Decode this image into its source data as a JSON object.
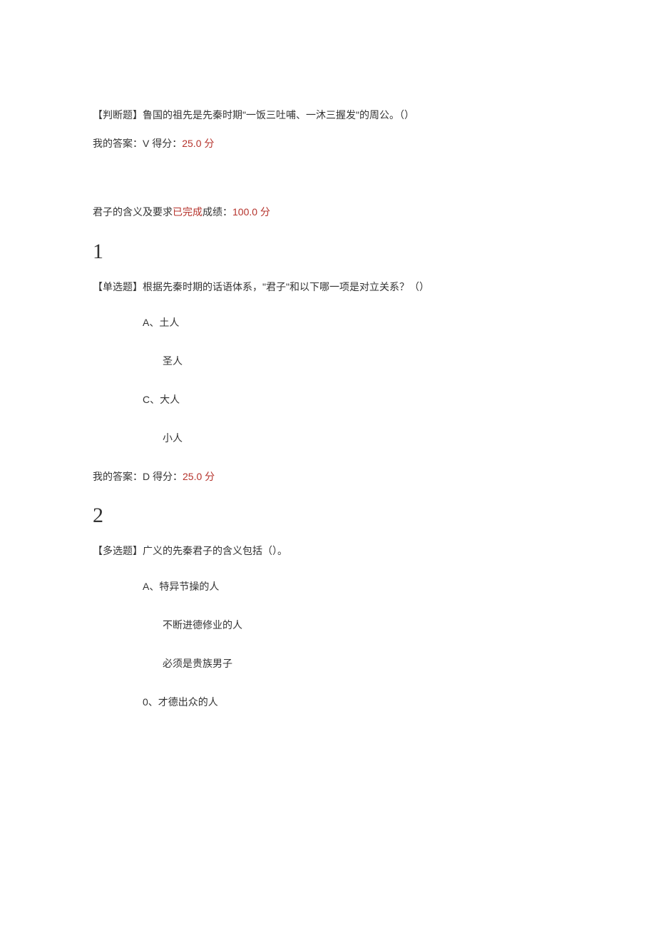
{
  "q0": {
    "prompt": "【判断题】鲁国的祖先是先秦时期\"一饭三吐哺、一沐三握发\"的周公。（）",
    "answer_prefix": "我的答案：V 得分：",
    "answer_score": "25.0 分"
  },
  "section": {
    "title_a": "君子的含义及要求",
    "status": "已完成",
    "title_b": "成绩：",
    "score": "100.0 分"
  },
  "q1": {
    "num": "1",
    "prompt": "【单选题】根据先秦时期的话语体系，\"君子\"和以下哪一项是对立关系？（）",
    "opt_a": "A、土人",
    "opt_b": "圣人",
    "opt_c": "C、大人",
    "opt_d": "小人",
    "answer_prefix": "我的答案：D 得分：",
    "answer_score": "25.0 分"
  },
  "q2": {
    "num": "2",
    "prompt": "【多选题】广义的先秦君子的含义包括（）。",
    "opt_a": "A、特异节操的人",
    "opt_b": "不断进德修业的人",
    "opt_c": "必须是贵族男子",
    "opt_d": "0、才德出众的人"
  }
}
